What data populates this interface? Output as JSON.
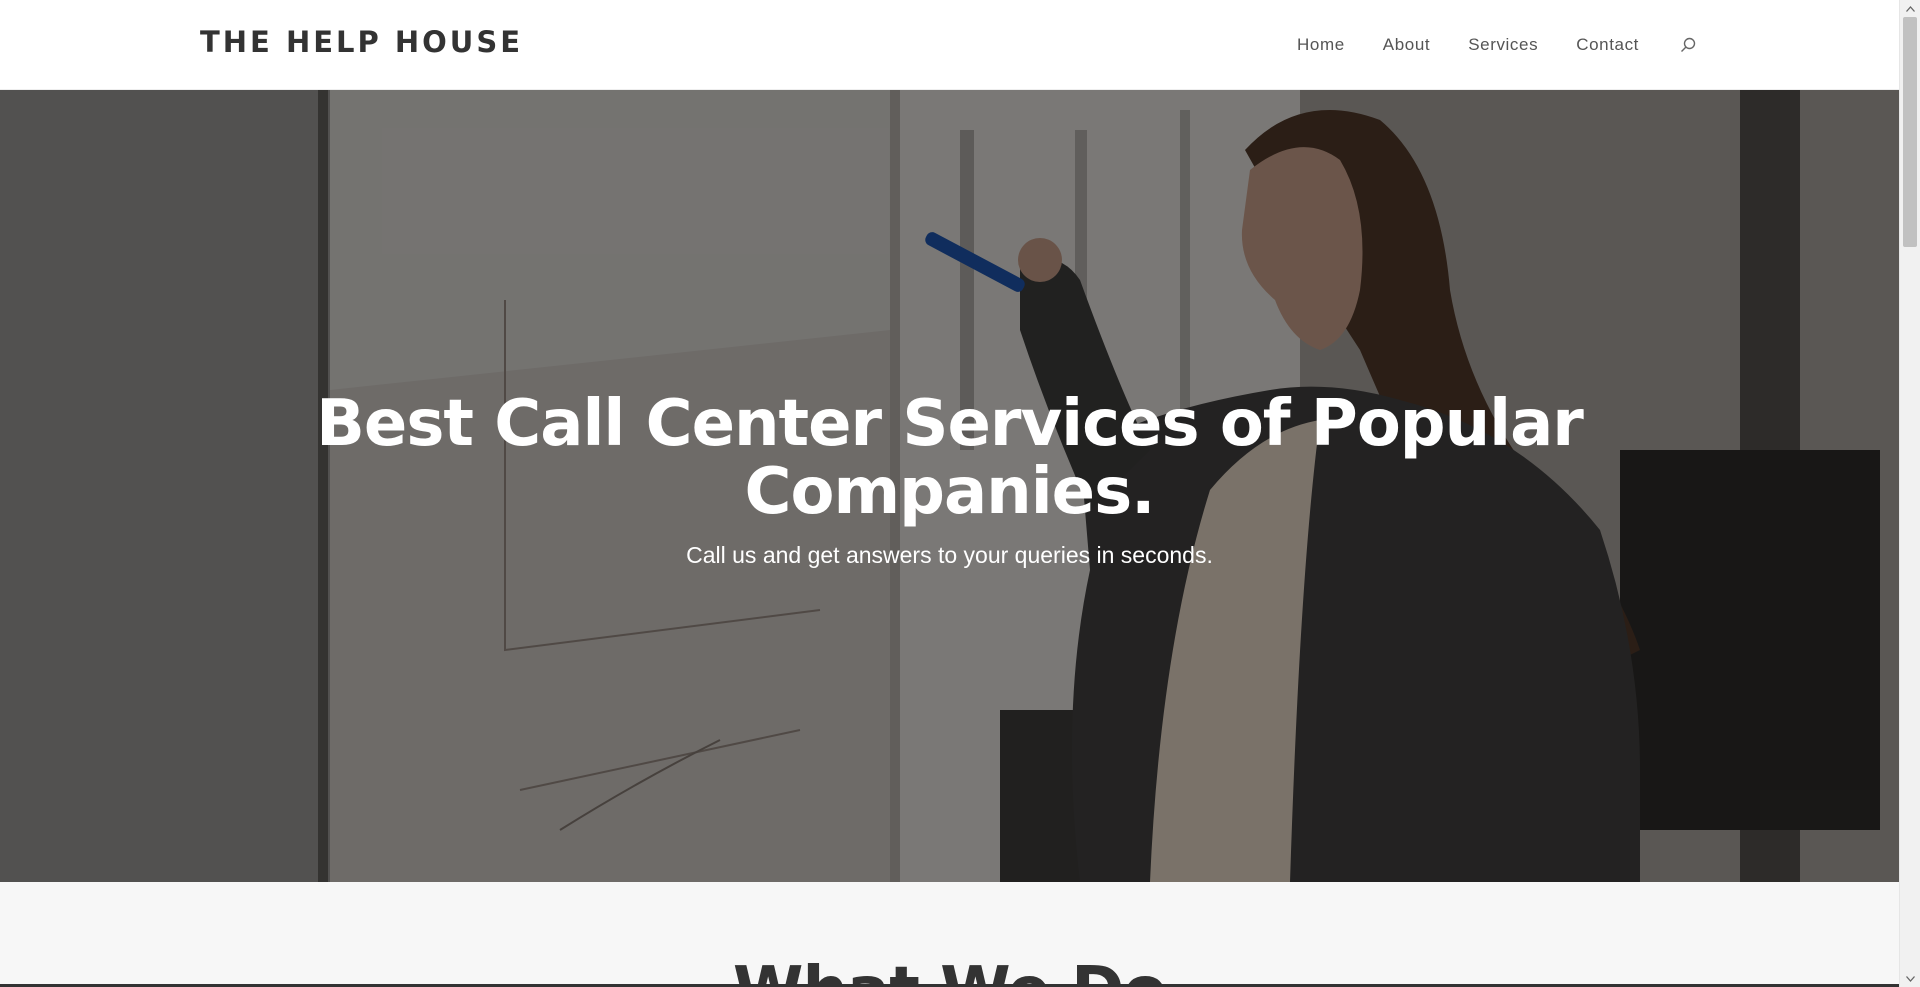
{
  "header": {
    "logo": "THE HELP HOUSE",
    "nav": [
      {
        "label": "Home"
      },
      {
        "label": "About"
      },
      {
        "label": "Services"
      },
      {
        "label": "Contact"
      }
    ],
    "search_icon": "search-icon"
  },
  "hero": {
    "title": "Best Call Center Services of Popular Companies.",
    "subtitle": "Call us and get answers to your queries in seconds."
  },
  "section": {
    "title": "What We Do"
  },
  "colors": {
    "text_dark": "#333333",
    "nav_text": "#555555",
    "hero_text": "#ffffff",
    "section_bg": "#f7f7f7"
  }
}
